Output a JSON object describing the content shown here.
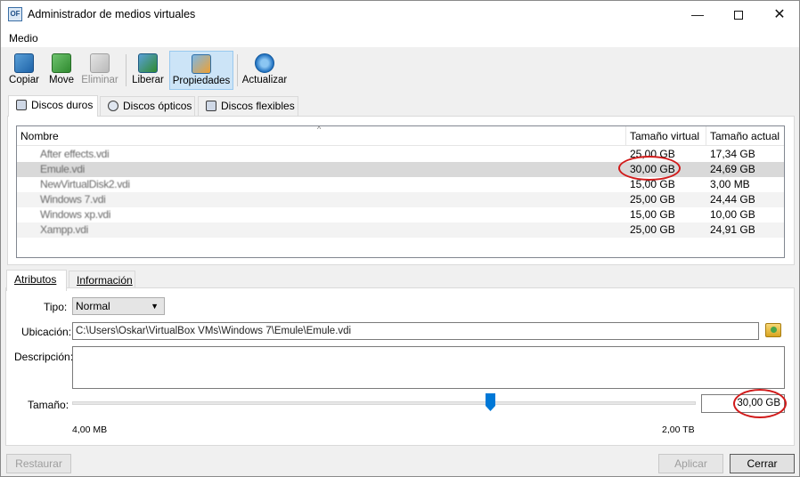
{
  "window": {
    "title": "Administrador de medios virtuales",
    "minimize_glyph": "—",
    "close_glyph": "✕",
    "icon_text": "OF"
  },
  "menu": {
    "items": [
      "Medio"
    ]
  },
  "toolbar": {
    "buttons": [
      {
        "label": "Copiar",
        "icon": "copy-icon",
        "enabled": true
      },
      {
        "label": "Move",
        "icon": "move-icon",
        "enabled": true
      },
      {
        "label": "Eliminar",
        "icon": "delete-icon",
        "enabled": false
      },
      {
        "label": "Liberar",
        "icon": "release-icon",
        "enabled": true
      },
      {
        "label": "Propiedades",
        "icon": "properties-icon",
        "enabled": true,
        "active": true
      },
      {
        "label": "Actualizar",
        "icon": "refresh-icon",
        "enabled": true
      }
    ]
  },
  "tabs": [
    {
      "label": "Discos duros",
      "selected": true
    },
    {
      "label": "Discos ópticos",
      "selected": false
    },
    {
      "label": "Discos flexibles",
      "selected": false
    }
  ],
  "list": {
    "sort_glyph": "^",
    "columns": [
      "Nombre",
      "Tamaño virtual",
      "Tamaño actual"
    ],
    "rows": [
      {
        "name": "After effects.vdi",
        "virtual": "25,00 GB",
        "actual": "17,34 GB"
      },
      {
        "name": "Emule.vdi",
        "virtual": "30,00 GB",
        "actual": "24,69 GB",
        "selected": true
      },
      {
        "name": "NewVirtualDisk2.vdi",
        "virtual": "15,00 GB",
        "actual": "3,00 MB"
      },
      {
        "name": "Windows 7.vdi",
        "virtual": "25,00 GB",
        "actual": "24,44 GB"
      },
      {
        "name": "Windows xp.vdi",
        "virtual": "15,00 GB",
        "actual": "10,00 GB"
      },
      {
        "name": "Xampp.vdi",
        "virtual": "25,00 GB",
        "actual": "24,91 GB"
      }
    ]
  },
  "detail_tabs": [
    {
      "label": "Atributos",
      "selected": true
    },
    {
      "label": "Información",
      "selected": false
    }
  ],
  "attributes": {
    "type_label": "Tipo:",
    "type_value": "Normal",
    "type_arrow": "▼",
    "location_label": "Ubicación:",
    "location_value": "C:\\Users\\Oskar\\VirtualBox VMs\\Windows 7\\Emule\\Emule.vdi",
    "description_label": "Descripción:",
    "description_value": "",
    "size_label": "Tamaño:",
    "size_value": "30,00 GB",
    "size_min": "4,00 MB",
    "size_max": "2,00 TB",
    "slider_fraction": 0.67
  },
  "buttons": {
    "reset": "Restaurar",
    "apply": "Aplicar",
    "close": "Cerrar"
  },
  "colors": {
    "annotation": "#d11a1a",
    "accent": "#0078d7",
    "selected_row": "#d9d9d9"
  }
}
